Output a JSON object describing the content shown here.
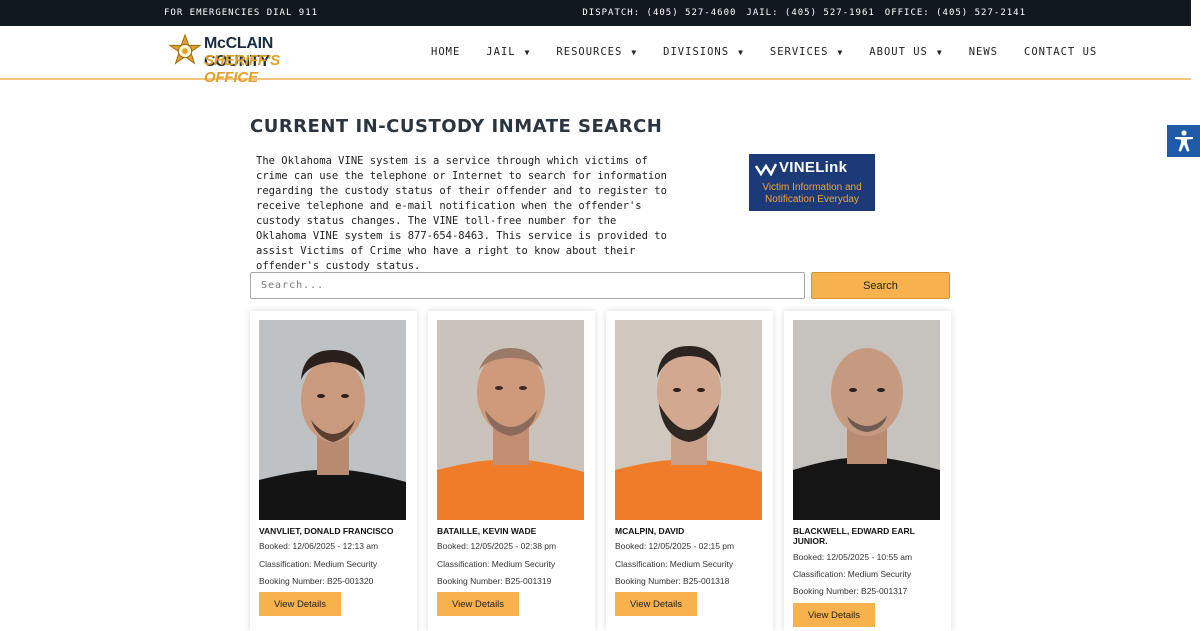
{
  "topbar": {
    "emergency": "FOR EMERGENCIES DIAL 911",
    "dispatch": "DISPATCH: (405) 527-4600",
    "jail": "JAIL: (405) 527-1961",
    "office": "OFFICE: (405) 527-2141"
  },
  "logo": {
    "line1": "McCLAIN COUNTY",
    "line2": "SHERIFF'S OFFICE"
  },
  "nav": [
    {
      "label": "HOME",
      "dropdown": false
    },
    {
      "label": "JAIL",
      "dropdown": true
    },
    {
      "label": "RESOURCES",
      "dropdown": true
    },
    {
      "label": "DIVISIONS",
      "dropdown": true
    },
    {
      "label": "SERVICES",
      "dropdown": true
    },
    {
      "label": "ABOUT US",
      "dropdown": true
    },
    {
      "label": "NEWS",
      "dropdown": false
    },
    {
      "label": "CONTACT US",
      "dropdown": false
    }
  ],
  "page": {
    "title": "CURRENT IN-CUSTODY INMATE SEARCH",
    "description": "The Oklahoma VINE system is a service through which victims of crime can use the telephone or Internet to search for information regarding the custody status of their offender and to register to receive telephone and e-mail notification when the offender's custody status changes. The VINE toll-free number for the Oklahoma VINE system is 877-654-8463. This service is provided to assist Victims of Crime who have a right to know about their offender's custody status."
  },
  "vine": {
    "brand": "VINELink",
    "tagline": "Victim Information and Notification Everyday"
  },
  "search": {
    "placeholder": "Search...",
    "button": "Search"
  },
  "inmates": [
    {
      "name": "VANVLIET, DONALD FRANCISCO",
      "booked": "Booked: 12/06/2025 - 12:13 am",
      "classification": "Classification: Medium Security",
      "booking": "Booking Number: B25-001320",
      "button": "View Details"
    },
    {
      "name": "BATAILLE, KEVIN WADE",
      "booked": "Booked: 12/05/2025 - 02:38 pm",
      "classification": "Classification: Medium Security",
      "booking": "Booking Number: B25-001319",
      "button": "View Details"
    },
    {
      "name": "MCALPIN, DAVID",
      "booked": "Booked: 12/05/2025 - 02:15 pm",
      "classification": "Classification: Medium Security",
      "booking": "Booking Number: B25-001318",
      "button": "View Details"
    },
    {
      "name": "BLACKWELL, EDWARD EARL JUNIOR.",
      "booked": "Booked: 12/05/2025 - 10:55 am",
      "classification": "Classification: Medium Security",
      "booking": "Booking Number: B25-001317",
      "button": "View Details"
    }
  ],
  "colors": {
    "accent": "#f7b24d",
    "topbar": "#111820",
    "a11y": "#1e5aa8",
    "vine_bg": "#1c3a78"
  }
}
